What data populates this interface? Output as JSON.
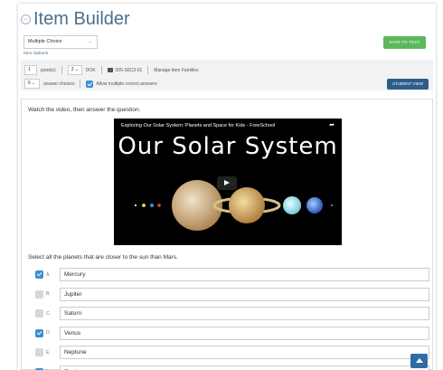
{
  "header": {
    "title": "Item Builder"
  },
  "toolbar": {
    "question_type": "Multiple Choice",
    "save_label": "SAVE TO TEST"
  },
  "options": {
    "label": "Item Options",
    "points_value": "1",
    "points_label": "point(s)",
    "dok_value": "2",
    "dok_label": "DOK",
    "standard_code": "005-S6C3-01",
    "manage_families": "Manage Item Families",
    "answer_choices_value": "6",
    "answer_choices_label": "answer choices",
    "allow_multiple_label": "Allow multiple correct answers",
    "student_view_label": "STUDENT VIEW"
  },
  "question": {
    "stem": "Watch the video, then answer the question.",
    "video_title": "Exploring Our Solar System: Planets and Space for Kids - FreeSchool",
    "video_heading": "Our Solar System",
    "prompt": "Select all the planets that are closer to the sun than Mars."
  },
  "answers": [
    {
      "letter": "A.",
      "text": "Mercury",
      "checked": true
    },
    {
      "letter": "B.",
      "text": "Jupiter",
      "checked": false
    },
    {
      "letter": "C.",
      "text": "Saturn",
      "checked": false
    },
    {
      "letter": "D.",
      "text": "Venus",
      "checked": true
    },
    {
      "letter": "E.",
      "text": "Neptune",
      "checked": false
    },
    {
      "letter": "F.",
      "text": "Earth",
      "checked": true
    }
  ],
  "colors": {
    "accent": "#3a8fd6",
    "save": "#5cb85c",
    "student_view": "#2e5c8a",
    "title": "#4a6f8c"
  }
}
